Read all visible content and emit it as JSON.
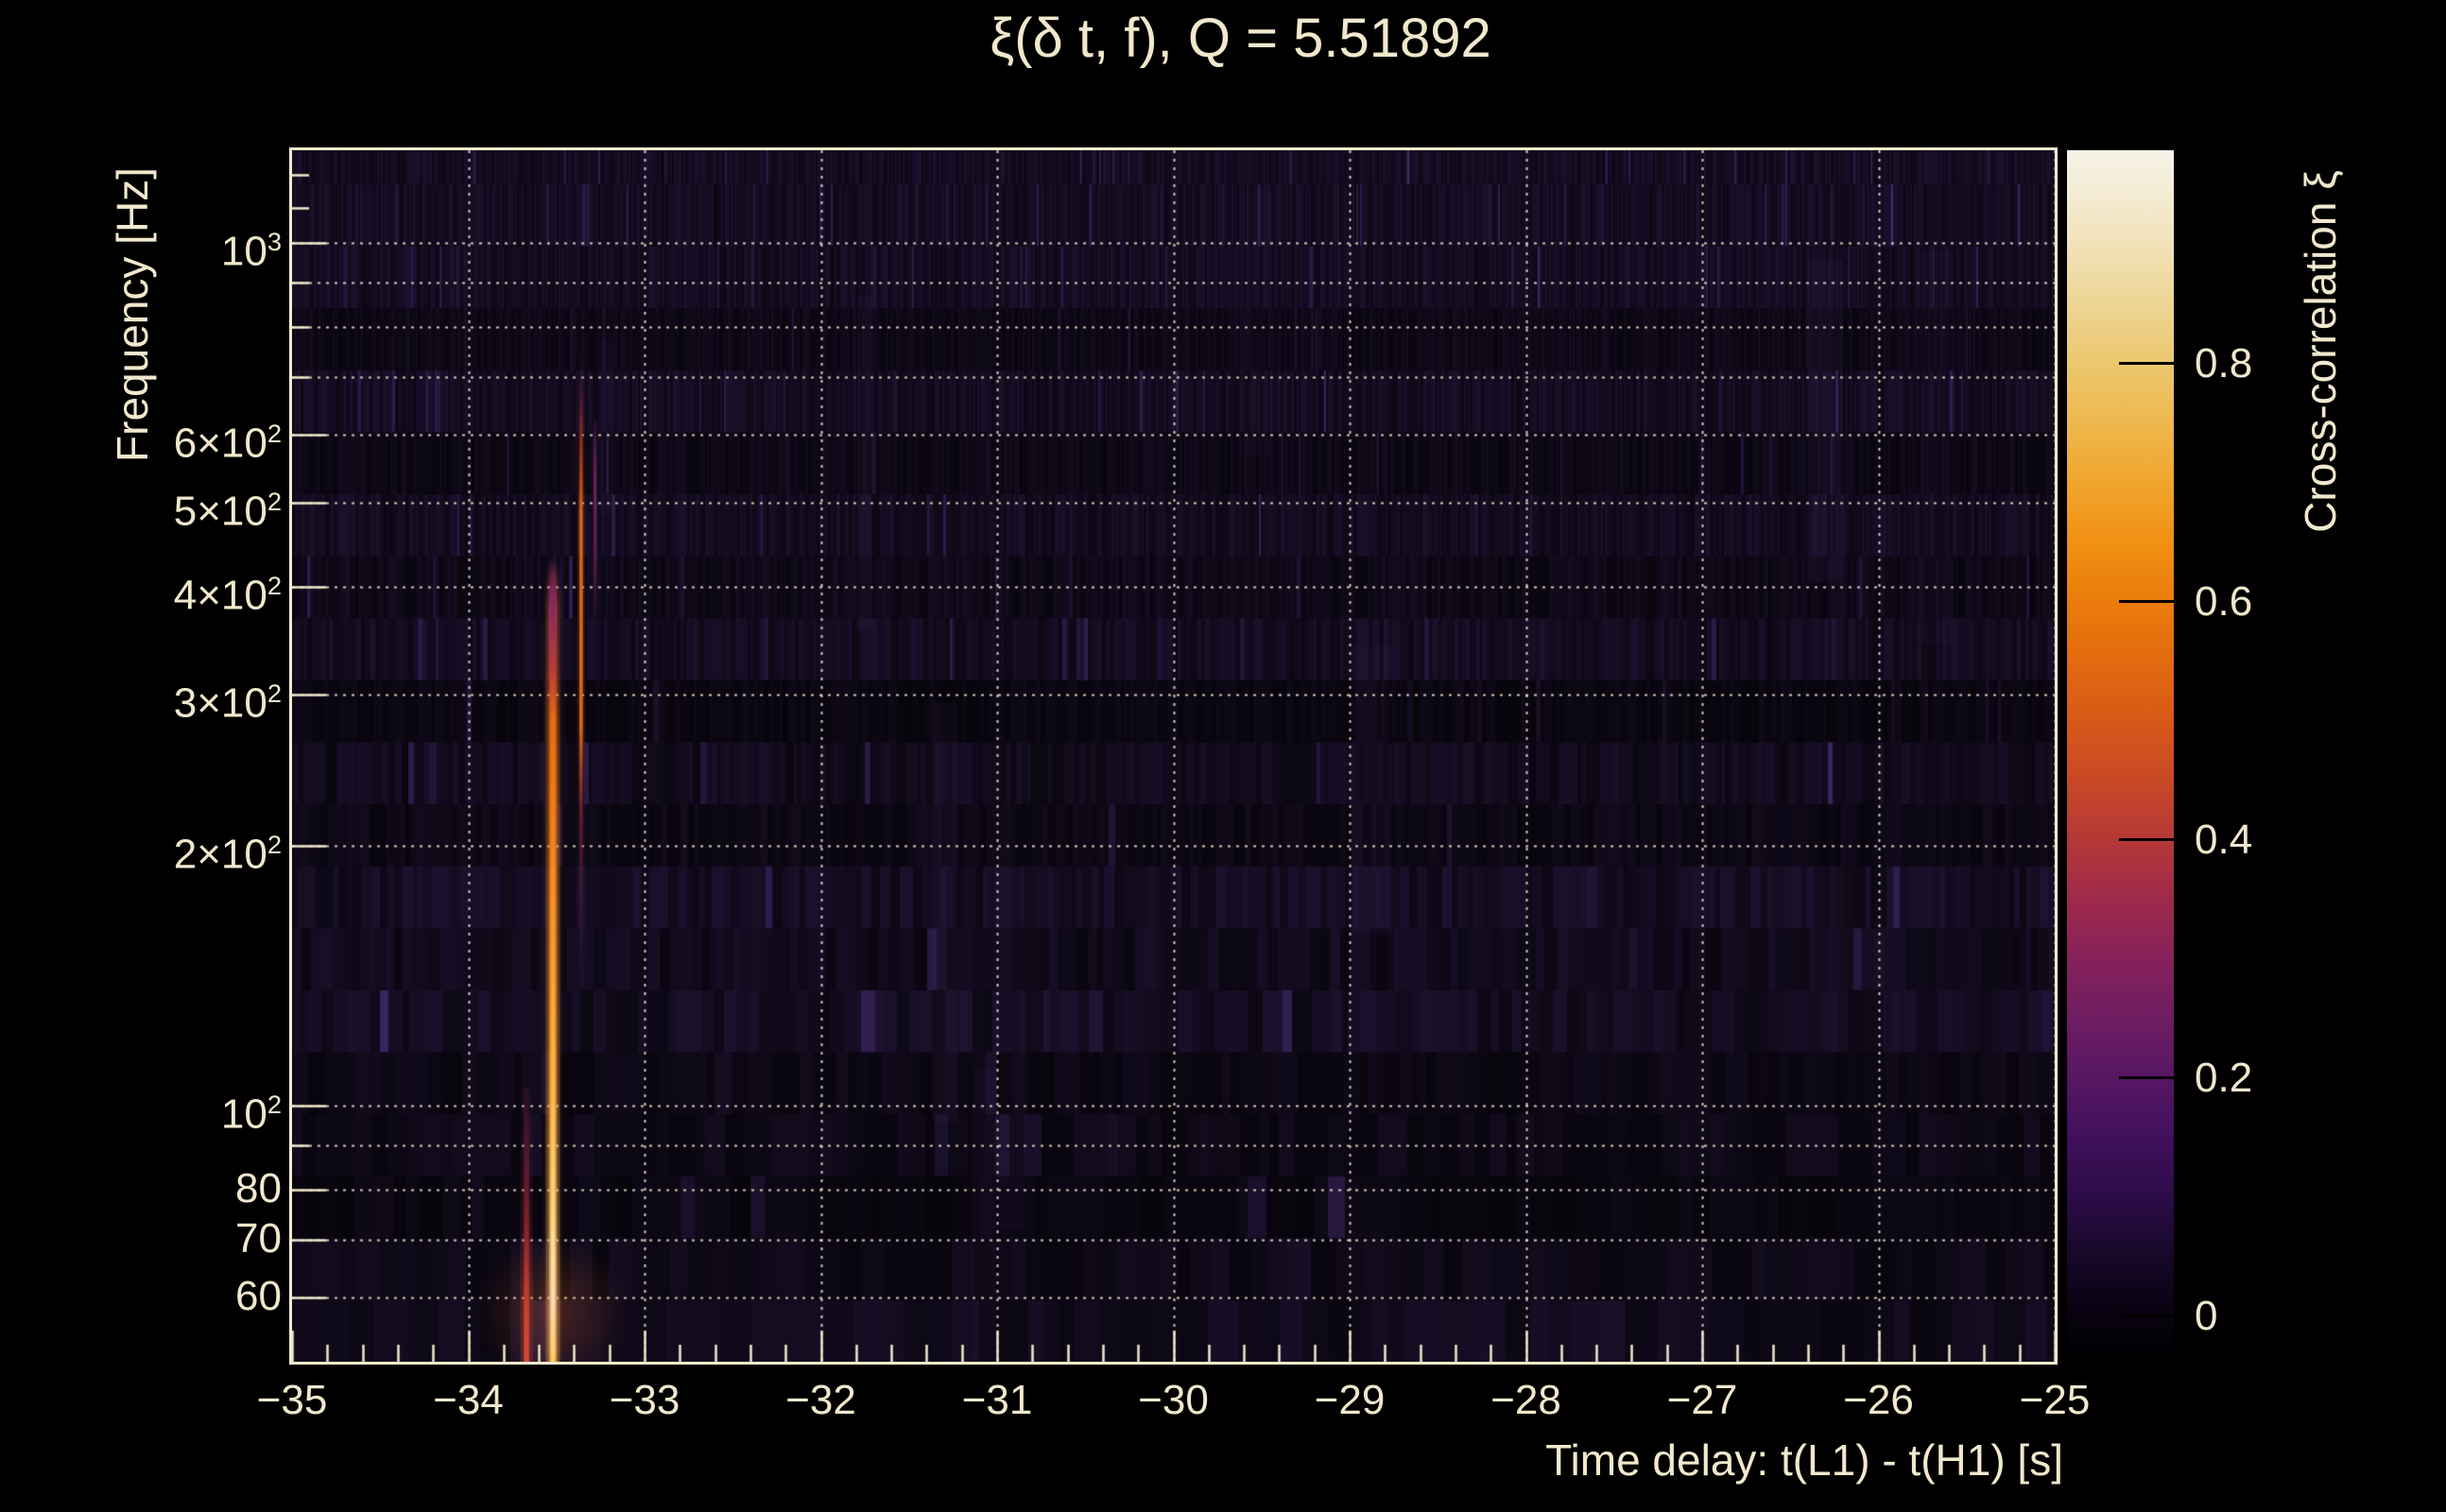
{
  "chart_data": {
    "type": "heatmap",
    "title": "ξ(δ t, f), Q = 5.51892",
    "xlabel": "Time delay: t(L1) - t(H1) [s]",
    "ylabel": "Frequency [Hz]",
    "x_range_s": [
      -35,
      -25
    ],
    "y_range_hz": [
      50.5,
      1282
    ],
    "y_scale": "log10",
    "grid": "dotted",
    "legend": "none",
    "x_ticks": [
      {
        "t": -35,
        "label": "−35"
      },
      {
        "t": -34,
        "label": "−34"
      },
      {
        "t": -33,
        "label": "−33"
      },
      {
        "t": -32,
        "label": "−32"
      },
      {
        "t": -31,
        "label": "−31"
      },
      {
        "t": -30,
        "label": "−30"
      },
      {
        "t": -29,
        "label": "−29"
      },
      {
        "t": -28,
        "label": "−28"
      },
      {
        "t": -27,
        "label": "−27"
      },
      {
        "t": -26,
        "label": "−26"
      },
      {
        "t": -25,
        "label": "−25"
      }
    ],
    "x_minor_tick_step": 0.2,
    "y_ticks": [
      {
        "f": 1000,
        "label": "10^3"
      },
      {
        "f": 600,
        "label": "6×10^2"
      },
      {
        "f": 500,
        "label": "5×10^2"
      },
      {
        "f": 400,
        "label": "4×10^2"
      },
      {
        "f": 300,
        "label": "3×10^2"
      },
      {
        "f": 200,
        "label": "2×10^2"
      },
      {
        "f": 100,
        "label": "10^2"
      },
      {
        "f": 80,
        "label": "80"
      },
      {
        "f": 70,
        "label": "70"
      },
      {
        "f": 60,
        "label": "60"
      }
    ],
    "y_minor_ticks_hz": [
      1200,
      1100,
      900,
      800,
      700,
      90
    ],
    "gridlines_x_s": [
      -34,
      -33,
      -32,
      -31,
      -30,
      -29,
      -28,
      -27,
      -26,
      -25
    ],
    "gridlines_y_hz": [
      1000,
      900,
      800,
      700,
      600,
      500,
      400,
      300,
      200,
      100,
      90,
      80,
      70,
      60
    ],
    "background_xi_level": 0.02,
    "features": [
      {
        "name": "primary-correlation-track",
        "t": -33.52,
        "f_lo": 50.5,
        "f_hi": 430,
        "peak_xi": 0.97,
        "profile": "bright"
      },
      {
        "name": "secondary-orange-track",
        "t": -33.36,
        "f_lo": 135,
        "f_hi": 745,
        "peak_xi": 0.55,
        "profile": "orange"
      },
      {
        "name": "faint-magenta-track",
        "t": -33.28,
        "f_lo": 370,
        "f_hi": 625,
        "peak_xi": 0.3,
        "profile": "magenta"
      },
      {
        "name": "red-low-frequency-track",
        "t": -33.67,
        "f_lo": 50.5,
        "f_hi": 105,
        "peak_xi": 0.45,
        "profile": "red"
      }
    ],
    "colorbar": {
      "label": "Cross-correlation ξ",
      "min": -0.035,
      "max": 0.979,
      "ticks": [
        {
          "v": 0.8,
          "label": "0.8"
        },
        {
          "v": 0.6,
          "label": "0.6"
        },
        {
          "v": 0.4,
          "label": "0.4"
        },
        {
          "v": 0.2,
          "label": "0.2"
        },
        {
          "v": 0.0,
          "label": "0"
        }
      ],
      "stops": [
        {
          "v": -0.035,
          "color": "#000002"
        },
        {
          "v": 0.0,
          "color": "#08020f"
        },
        {
          "v": 0.05,
          "color": "#170828"
        },
        {
          "v": 0.1,
          "color": "#2b0c47"
        },
        {
          "v": 0.15,
          "color": "#41105c"
        },
        {
          "v": 0.2,
          "color": "#571763"
        },
        {
          "v": 0.25,
          "color": "#6e1d62"
        },
        {
          "v": 0.3,
          "color": "#86215b"
        },
        {
          "v": 0.35,
          "color": "#9e2a4b"
        },
        {
          "v": 0.4,
          "color": "#b53837"
        },
        {
          "v": 0.45,
          "color": "#c84826"
        },
        {
          "v": 0.5,
          "color": "#d75918"
        },
        {
          "v": 0.55,
          "color": "#e26a0f"
        },
        {
          "v": 0.6,
          "color": "#ea7c0b"
        },
        {
          "v": 0.65,
          "color": "#f09014"
        },
        {
          "v": 0.7,
          "color": "#f1a52d"
        },
        {
          "v": 0.75,
          "color": "#eeb84e"
        },
        {
          "v": 0.8,
          "color": "#ebc76e"
        },
        {
          "v": 0.85,
          "color": "#edd594"
        },
        {
          "v": 0.9,
          "color": "#f1e2b8"
        },
        {
          "v": 0.95,
          "color": "#f4edd8"
        },
        {
          "v": 0.979,
          "color": "#f6f2e8"
        }
      ]
    },
    "colors": {
      "text": "#f1e8cd",
      "frame": "#f2e9cd",
      "gridline": "rgba(245,236,212,0.85)",
      "plot_background": "#150a21",
      "page_background": "#000000"
    }
  }
}
